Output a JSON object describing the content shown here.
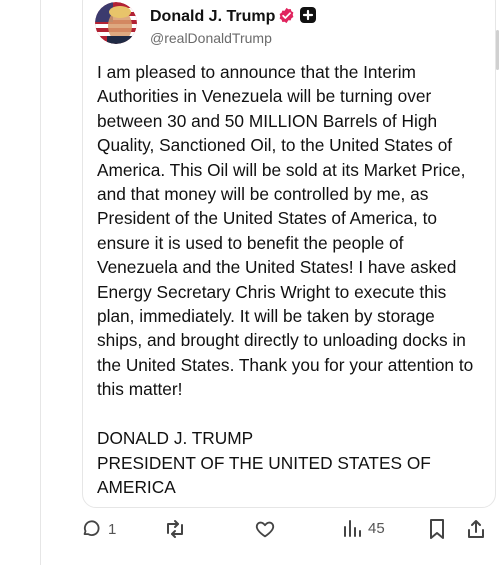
{
  "author": {
    "name": "Donald J. Trump",
    "handle": "@realDonaldTrump",
    "avatar_icon": "avatar-flag-portrait",
    "verified_icon": "verified-badge-icon",
    "badge_icon": "plus-badge-icon",
    "verified_color": "#e0245e"
  },
  "post": {
    "body": "I am pleased to announce that the Interim Authorities in Venezuela will be turning over between 30 and 50 MILLION Barrels of High Quality, Sanctioned Oil, to the United States of America. This Oil will be sold at its Market Price, and that money will be controlled by me, as President of the United States of America, to ensure it is used to benefit the people of Venezuela and the United States! I have asked Energy Secretary Chris Wright to execute this plan, immediately. It will be taken by storage ships, and brought directly to unloading docks in the United States. Thank you for your attention to this matter!\n\nDONALD J. TRUMP\nPRESIDENT OF THE UNITED STATES OF AMERICA"
  },
  "actions": {
    "reply": {
      "icon": "reply-icon",
      "count": "1"
    },
    "repost": {
      "icon": "repost-icon"
    },
    "like": {
      "icon": "heart-icon"
    },
    "views": {
      "icon": "views-icon",
      "count": "45"
    },
    "bookmark": {
      "icon": "bookmark-icon"
    },
    "share": {
      "icon": "share-icon"
    }
  }
}
